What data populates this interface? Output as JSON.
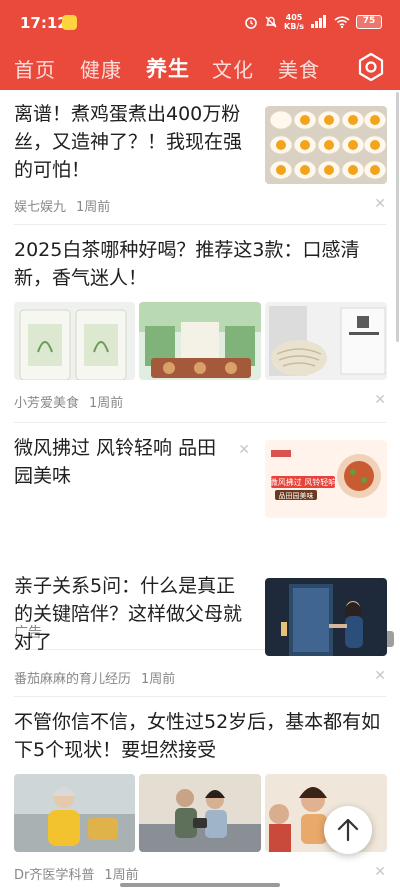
{
  "status": {
    "time": "17:12",
    "net_speed_value": "405",
    "net_speed_unit": "KB/s",
    "signal": "5G",
    "battery": "75"
  },
  "nav": {
    "tabs": [
      "首页",
      "健康",
      "养生",
      "文化",
      "美食"
    ],
    "active_tab": "养生"
  },
  "feed": [
    {
      "title": "离谱！煮鸡蛋煮出400万粉丝，又造神了？！我现在强的可怕！",
      "author": "娱七娱九",
      "time": "1周前"
    },
    {
      "title": "2025白茶哪种好喝？推荐这3款：口感清新，香气迷人！",
      "author": "小芳爱美食",
      "time": "1周前"
    },
    {
      "title": "微风拂过 风铃轻响 品田园美味",
      "ad_label": "广告",
      "ad_badge": "广告",
      "ad_image_text": "微风拂过 风铃轻响",
      "ad_image_text2": "品田园美味"
    },
    {
      "title": "亲子关系5问：什么是真正的关键陪伴？这样做父母就对了",
      "author": "番茄麻麻的育儿经历",
      "time": "1周前"
    },
    {
      "title": "不管你信不信，女性过52岁后，基本都有如下5个现状！要坦然接受",
      "author": "Dr齐医学科普",
      "time": "1周前"
    }
  ],
  "colors": {
    "brand": "#e94a3c"
  }
}
